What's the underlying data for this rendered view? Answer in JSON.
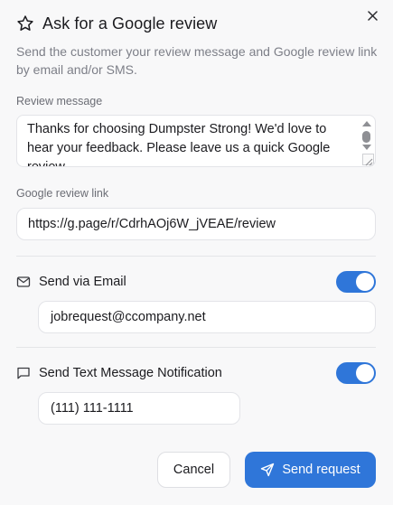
{
  "dialog": {
    "title": "Ask for a Google review",
    "subtitle": "Send the customer your review message and Google review link by email and/or SMS.",
    "close_icon": "close-icon",
    "title_icon": "star-outline-icon"
  },
  "review_message": {
    "label": "Review message",
    "value": "Thanks for choosing Dumpster Strong! We'd love to hear your feedback. Please leave us a quick Google review."
  },
  "review_link": {
    "label": "Google review link",
    "value": "https://g.page/r/CdrhAOj6W_jVEAE/review"
  },
  "email": {
    "label": "Send via Email",
    "icon": "mail-icon",
    "enabled": true,
    "value": "jobrequest@ccompany.net"
  },
  "sms": {
    "label": "Send Text Message Notification",
    "icon": "message-square-icon",
    "enabled": true,
    "value": "(111) 111-1111"
  },
  "actions": {
    "cancel_label": "Cancel",
    "send_label": "Send request",
    "send_icon": "send-icon"
  },
  "colors": {
    "accent": "#2f76d9",
    "background": "#f8f8f9",
    "muted_text": "#7d7f88"
  }
}
